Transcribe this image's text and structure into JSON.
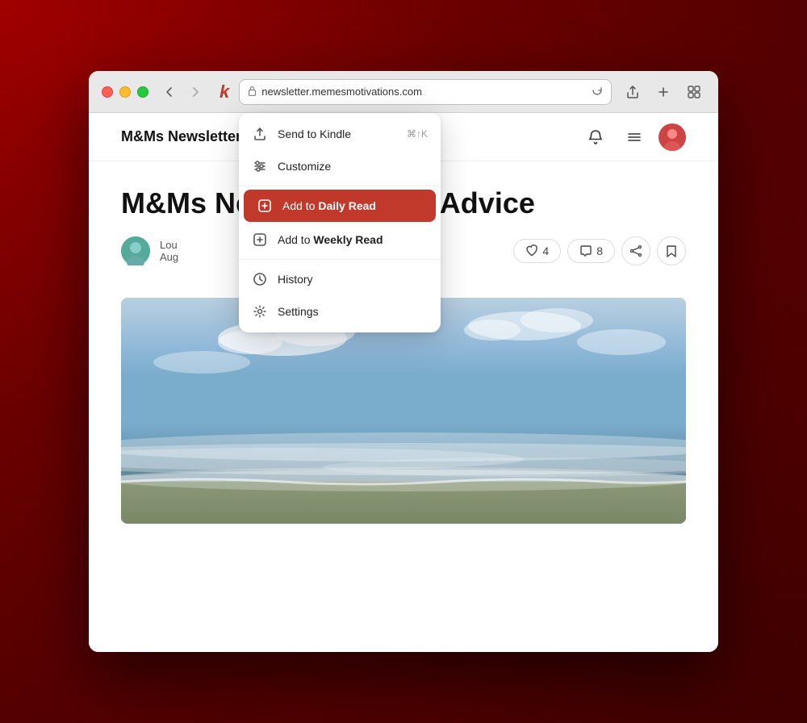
{
  "desktop": {
    "bg": "radial-gradient(ellipse at top left, #a00000 0%, #6b0000 40%, #3d0000 100%)"
  },
  "browser": {
    "url": "newsletter.memesmotivations.com",
    "kindle_logo": "k"
  },
  "site": {
    "title": "M&Ms Newsletter",
    "article_title": "M&Ms Newsletter... ive Advice"
  },
  "author": {
    "name": "Lou",
    "date": "Aug"
  },
  "article_actions": {
    "likes": "4",
    "comments": "8"
  },
  "menu": {
    "items": [
      {
        "id": "send-to-kindle",
        "label": "Send to Kindle",
        "shortcut": "⌘↑K",
        "icon": "upload"
      },
      {
        "id": "customize",
        "label": "Customize",
        "shortcut": "",
        "icon": "sliders"
      },
      {
        "id": "add-daily-read",
        "label_prefix": "Add to ",
        "label_bold": "Daily Read",
        "shortcut": "",
        "icon": "plus-square",
        "active": true
      },
      {
        "id": "add-weekly-read",
        "label_prefix": "Add to ",
        "label_bold": "Weekly Read",
        "shortcut": "",
        "icon": "plus-square-outline",
        "active": false
      },
      {
        "id": "history",
        "label": "History",
        "shortcut": "",
        "icon": "clock"
      },
      {
        "id": "settings",
        "label": "Settings",
        "shortcut": "",
        "icon": "gear"
      }
    ]
  }
}
